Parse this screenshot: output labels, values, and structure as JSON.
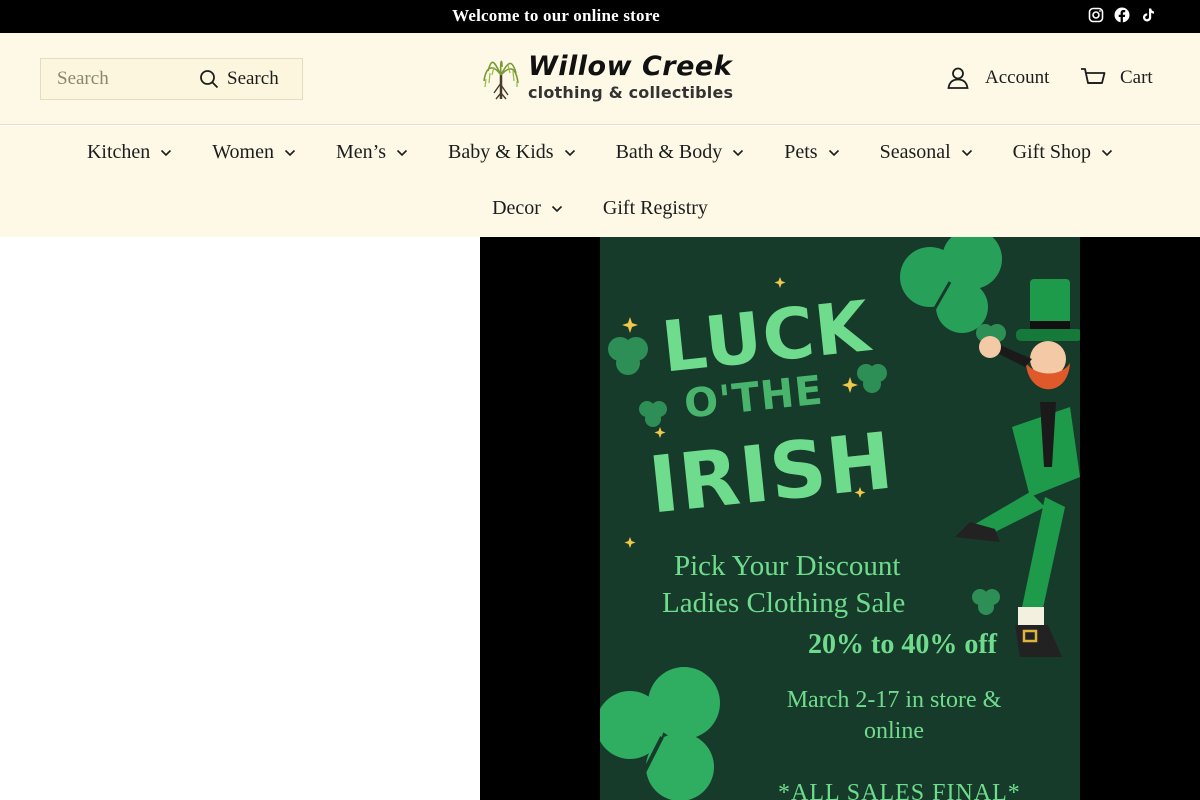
{
  "announcement": {
    "text": "Welcome to our online store"
  },
  "social": [
    "instagram-icon",
    "facebook-icon",
    "tiktok-icon"
  ],
  "header": {
    "search_placeholder": "Search",
    "search_button": "Search",
    "logo_name": "Willow Creek",
    "logo_tagline": "clothing & collectibles",
    "account_label": "Account",
    "cart_label": "Cart"
  },
  "nav": {
    "items": [
      {
        "label": "Kitchen",
        "has_dropdown": true
      },
      {
        "label": "Women",
        "has_dropdown": true
      },
      {
        "label": "Men’s",
        "has_dropdown": true
      },
      {
        "label": "Baby & Kids",
        "has_dropdown": true
      },
      {
        "label": "Bath & Body",
        "has_dropdown": true
      },
      {
        "label": "Pets",
        "has_dropdown": true
      },
      {
        "label": "Seasonal",
        "has_dropdown": true
      },
      {
        "label": "Gift Shop",
        "has_dropdown": true
      },
      {
        "label": "Decor",
        "has_dropdown": true
      },
      {
        "label": "Gift Registry",
        "has_dropdown": false
      }
    ]
  },
  "hero": {
    "title_1": "LUCK",
    "title_2": "O'THE",
    "title_3": "IRISH",
    "line_1": "Pick Your Discount",
    "line_2": "Ladies Clothing Sale",
    "line_3": "20% to 40% off",
    "line_4": "March 2-17 in store & online",
    "line_5": "*ALL SALES FINAL*"
  },
  "colors": {
    "announcement_bg": "#000000",
    "header_bg": "#fdf9e6",
    "poster_bg": "#173b2a",
    "poster_text": "#6fdc8d"
  }
}
